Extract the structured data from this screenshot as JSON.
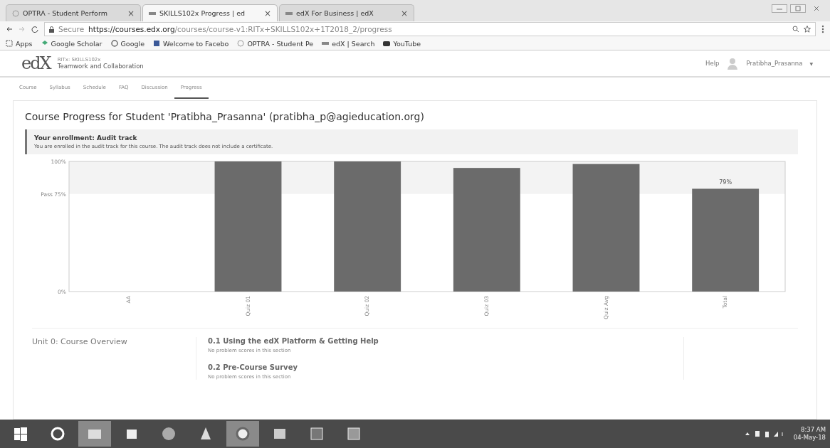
{
  "browser": {
    "tabs": [
      {
        "title": "OPTRA - Student Perform",
        "selected": false
      },
      {
        "title": "SKILLS102x Progress | ed",
        "selected": true
      },
      {
        "title": "edX For Business | edX",
        "selected": false
      }
    ],
    "close_glyph": "×",
    "secure_label": "Secure",
    "url_host": "https://courses.edx.org",
    "url_path": "/courses/course-v1:RITx+SKILLS102x+1T2018_2/progress",
    "bookmarks": [
      "Apps",
      "Google Scholar",
      "Google",
      "Welcome to Facebo",
      "OPTRA - Student Pe",
      "edX | Search",
      "YouTube"
    ]
  },
  "header": {
    "logo": "edX",
    "course_org": "RITx: SKILLS102x",
    "course_name": "Teamwork and Collaboration",
    "help": "Help",
    "user": "Pratibha_Prasanna",
    "caret": "▼"
  },
  "course_tabs": [
    {
      "label": "Course",
      "selected": false
    },
    {
      "label": "Syllabus",
      "selected": false
    },
    {
      "label": "Schedule",
      "selected": false
    },
    {
      "label": "FAQ",
      "selected": false
    },
    {
      "label": "Discussion",
      "selected": false
    },
    {
      "label": "Progress",
      "selected": true
    }
  ],
  "progress": {
    "title": "Course Progress for Student 'Pratibha_Prasanna' (pratibha_p@agieducation.org)",
    "enrollment": {
      "title": "Your enrollment: Audit track",
      "text": "You are enrolled in the audit track for this course. The audit track does not include a certificate."
    },
    "chart_data": {
      "type": "bar",
      "categories": [
        "AA",
        "Quiz 01",
        "Quiz 02",
        "Quiz 03",
        "Quiz Avg",
        "Total"
      ],
      "series": [
        {
          "color": "#6b6b6b",
          "values": [
            0,
            1,
            1,
            0.95,
            0.98,
            0.79
          ]
        }
      ],
      "ylim": [
        0,
        1
      ],
      "yticks": [
        {
          "value": 0,
          "label": "0%"
        },
        {
          "value": 0.75,
          "label": "Pass 75%"
        },
        {
          "value": 1,
          "label": "100%"
        }
      ],
      "value_labels": [
        null,
        null,
        null,
        null,
        null,
        "79%"
      ]
    },
    "sections": [
      {
        "title": "Unit 0: Course Overview",
        "subsections": [
          {
            "title": "0.1 Using the edX Platform & Getting Help",
            "note": "No problem scores in this section"
          },
          {
            "title": "0.2 Pre-Course Survey",
            "note": "No problem scores in this section"
          }
        ]
      }
    ]
  },
  "taskbar": {
    "apps": [
      {
        "active": false
      },
      {
        "active": false
      },
      {
        "active": true
      },
      {
        "active": false
      },
      {
        "active": false
      },
      {
        "active": false
      },
      {
        "active": true
      },
      {
        "active": false
      },
      {
        "active": false
      },
      {
        "active": false
      }
    ],
    "time": "8:37 AM",
    "date": "04-May-18"
  }
}
